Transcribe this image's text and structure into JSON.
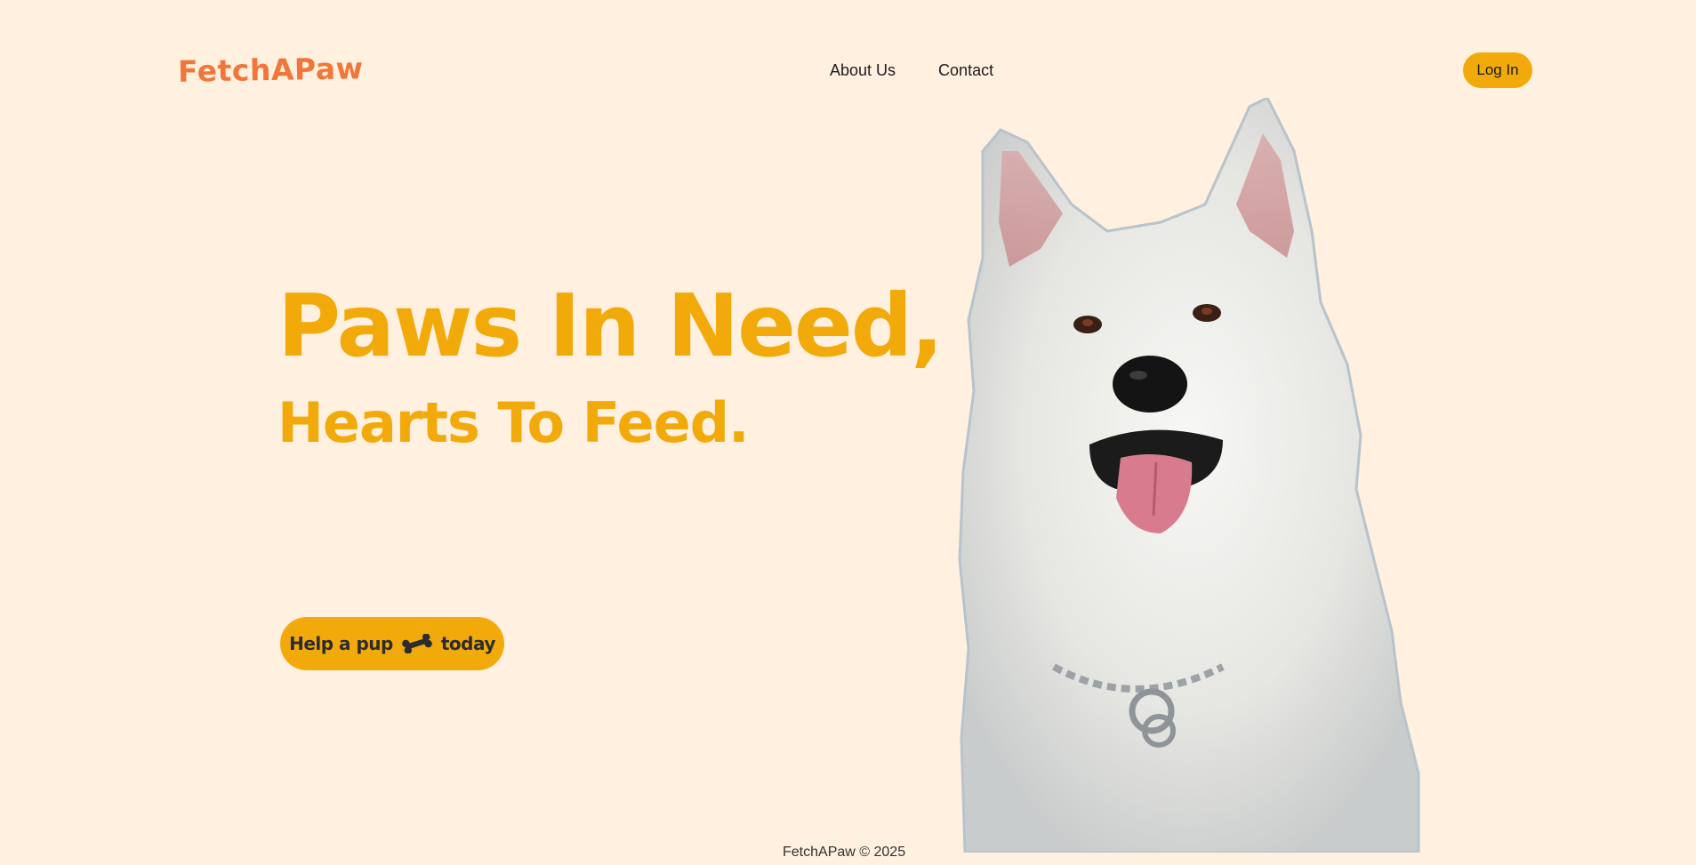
{
  "brand": {
    "logo_text": "FetchAPaw",
    "logo_color": "#f2763a",
    "accent_color": "#f2aa0b",
    "background_color": "#fff0e0"
  },
  "nav": {
    "items": [
      {
        "label": "About Us"
      },
      {
        "label": "Contact"
      }
    ],
    "login_label": "Log In"
  },
  "hero": {
    "headline": "Paws In Need,",
    "subheadline": "Hearts To Feed.",
    "cta": {
      "text_before": "Help a pup",
      "icon": "bone-icon",
      "text_after": "today"
    },
    "image": "white-husky-dog-photo"
  },
  "footer": {
    "text": "FetchAPaw © 2025"
  }
}
